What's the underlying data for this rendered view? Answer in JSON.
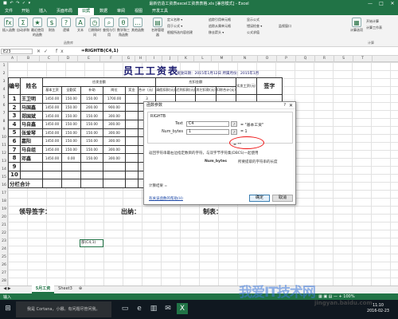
{
  "window": {
    "title": "最新仿造工资表excel工资表表格.xls [兼容模式] - Excel",
    "qat": "■ ↶ ↷ ✓ ▾",
    "minimize": "—",
    "maximize": "□",
    "close": "✕"
  },
  "ribbon_tabs": [
    "文件",
    "开始",
    "插入",
    "页面布局",
    "公式",
    "数据",
    "审阅",
    "视图",
    "开发工具"
  ],
  "ribbon": {
    "group_function_library": "函数库",
    "group_calculation": "计算",
    "buttons": [
      {
        "icon": "fx",
        "label": "插入函数"
      },
      {
        "icon": "Σ",
        "label": "自动求和"
      },
      {
        "icon": "★",
        "label": "最近使用的函数"
      },
      {
        "icon": "$",
        "label": "财务"
      },
      {
        "icon": "?",
        "label": "逻辑"
      },
      {
        "icon": "A",
        "label": "文本"
      },
      {
        "icon": "◷",
        "label": "日期和时间"
      },
      {
        "icon": "⌕",
        "label": "查找与引用"
      },
      {
        "icon": "θ",
        "label": "数学和三角函数"
      },
      {
        "icon": "…",
        "label": "其他函数"
      },
      {
        "icon": "▤",
        "label": "名称管理器"
      },
      {
        "icon": "▦",
        "label": "计算选项"
      }
    ],
    "small_items": [
      "定义名称 ▾",
      "用于公式 ▾",
      "根据所选内容创建",
      "追踪引用单元格",
      "追踪从属单元格",
      "移去箭头 ▾",
      "显示公式",
      "错误检查 ▾",
      "公式求值",
      "监视窗口",
      "开始计算",
      "计算工作表"
    ]
  },
  "namebox": "E23",
  "fx_icons": "✕✓ fx",
  "formula": "=RIGHTB(C4,1)",
  "columns": [
    "A",
    "B",
    "C",
    "D",
    "E",
    "F",
    "G",
    "H",
    "I",
    "J",
    "K",
    "L",
    "M",
    "N",
    "O",
    "P",
    "Q",
    "R",
    "S",
    "T"
  ],
  "rows": [
    "1",
    "2",
    "3",
    "4",
    "5",
    "6",
    "7",
    "8",
    "9",
    "10",
    "11",
    "12",
    "13",
    "14",
    "15",
    "16",
    "17",
    "18",
    "19",
    "20",
    "21",
    "22",
    "23",
    "24",
    "25",
    "26",
    "27",
    "28"
  ],
  "sheet": {
    "title": "员工工资表",
    "date_text": "发放日期：2015年1月12日  所属月份：2015年1月",
    "h_num": "编号",
    "h_name": "姓名",
    "h_payable": "应发金额",
    "h_deduct": "应扣金额",
    "h_actual": "实发工资(元)",
    "h_sign": "签字",
    "sub": [
      "基本工资",
      "全勤奖",
      "补助",
      "岗位",
      "奖金",
      "合计（元）",
      "请假扣款(元)",
      "迟到扣款(元)",
      "其它扣款(元)",
      "扣除合计(元)"
    ],
    "employees": [
      {
        "id": "1",
        "name": "王卫明",
        "basic": "1450.00",
        "attend": "150.00",
        "sub": "150.00",
        "post": "1700.00",
        "bonus": "",
        "total": "3"
      },
      {
        "id": "2",
        "name": "马国鑫",
        "basic": "1450.00",
        "attend": "150.00",
        "sub": "200.00",
        "post": "900.00",
        "bonus": "",
        "total": "2"
      },
      {
        "id": "3",
        "name": "郑国斌",
        "basic": "1450.00",
        "attend": "150.00",
        "sub": "150.00",
        "post": "300.00",
        "bonus": "",
        "total": "2"
      },
      {
        "id": "4",
        "name": "马自鑫",
        "basic": "1450.00",
        "attend": "150.00",
        "sub": "150.00",
        "post": "300.00",
        "bonus": "",
        "total": "2"
      },
      {
        "id": "5",
        "name": "张爱琴",
        "basic": "1450.00",
        "attend": "150.00",
        "sub": "150.00",
        "post": "300.00",
        "bonus": "",
        "total": "2"
      },
      {
        "id": "6",
        "name": "嘉阳",
        "basic": "1450.00",
        "attend": "150.00",
        "sub": "150.00",
        "post": "300.00",
        "bonus": "",
        "total": "2"
      },
      {
        "id": "7",
        "name": "马自组",
        "basic": "1450.00",
        "attend": "150.00",
        "sub": "150.00",
        "post": "300.00",
        "bonus": "",
        "total": "2"
      },
      {
        "id": "8",
        "name": "邓鑫",
        "basic": "1450.00",
        "attend": "0.00",
        "sub": "150.00",
        "post": "300.00",
        "bonus": "",
        "total": "2"
      },
      {
        "id": "9",
        "name": "",
        "basic": "",
        "attend": "",
        "sub": "",
        "post": "",
        "bonus": "",
        "total": "0"
      },
      {
        "id": "10",
        "name": "",
        "basic": "",
        "attend": "",
        "sub": "",
        "post": "",
        "bonus": "",
        "total": "0"
      }
    ],
    "total_label": "分栏合计",
    "leader_sign": "领导签字：",
    "cashier": "出纳：",
    "preparer": "制表：",
    "cell_e23": "部(C4,1)"
  },
  "dialog": {
    "title": "函数参数",
    "help_q": "?",
    "close": "✕",
    "func_name": "RIGHTB",
    "arg1_label": "Text",
    "arg1_value": "C4",
    "arg1_result": "= \"基本工资\"",
    "arg2_label": "Num_bytes",
    "arg2_value": "1",
    "arg2_result": "= 1",
    "result_line": "= \"\"",
    "ref_btn": "↗",
    "desc1": "返回字符串最右边指定数目的字符，与双字节字符集(DBCS)一起使用",
    "desc2_label": "Num_bytes",
    "desc2": "所要提取的字符串的长度",
    "calc_result": "计算结果 =",
    "help_link": "有关该函数的帮助(H)",
    "ok": "确定",
    "cancel": "取消"
  },
  "sheet_tabs": {
    "active": "5月工资",
    "other": "Sheet3",
    "add": "⊕"
  },
  "status": {
    "left": "输入",
    "right": "▦ ▣ ▤  —  + 100%"
  },
  "taskbar": {
    "start": "⊞",
    "cortana": "我是 Cortana，小娜。有问题尽管问我。",
    "icons": [
      "▭",
      "e",
      "▥",
      "✉",
      "X"
    ],
    "time": "11:10",
    "date": "2016-02-23"
  },
  "watermark": {
    "main": "我爱IT技术网",
    "url": "jingyan.baidu.com"
  }
}
